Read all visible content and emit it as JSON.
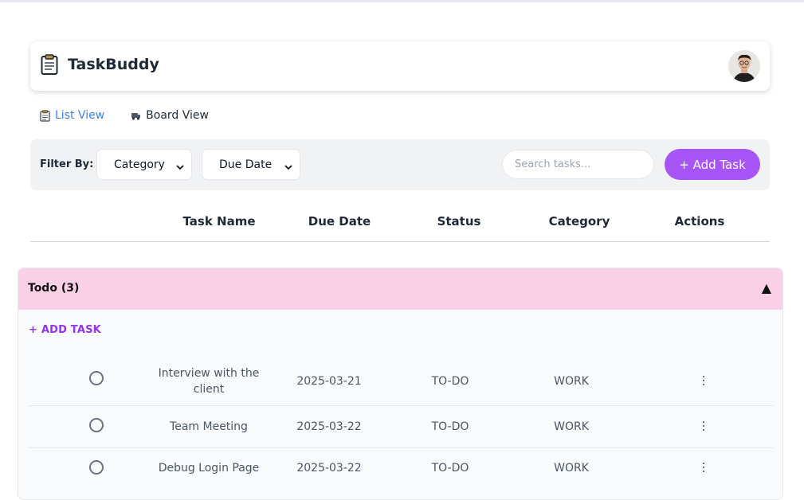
{
  "app": {
    "title": "TaskBuddy"
  },
  "tabs": [
    {
      "label": "List View",
      "active": true
    },
    {
      "label": "Board View",
      "active": false
    }
  ],
  "filter": {
    "label": "Filter By:",
    "category": "Category",
    "due_date": "Due Date",
    "search_placeholder": "Search tasks...",
    "add_button": "+ Add Task"
  },
  "columns": [
    "Task Name",
    "Due Date",
    "Status",
    "Category",
    "Actions"
  ],
  "group": {
    "title": "Todo (3)",
    "toggle": "▲",
    "add_task": "+ ADD TASK",
    "tasks": [
      {
        "name": "Interview with the client",
        "due": "2025-03-21",
        "status": "TO-DO",
        "category": "WORK"
      },
      {
        "name": "Team Meeting",
        "due": "2025-03-22",
        "status": "TO-DO",
        "category": "WORK"
      },
      {
        "name": "Debug Login Page",
        "due": "2025-03-22",
        "status": "TO-DO",
        "category": "WORK"
      }
    ]
  },
  "colors": {
    "accent": "#a855f7",
    "link": "#3b82f6",
    "group_header": "#fad0e6",
    "add_task_link": "#9333ea"
  }
}
